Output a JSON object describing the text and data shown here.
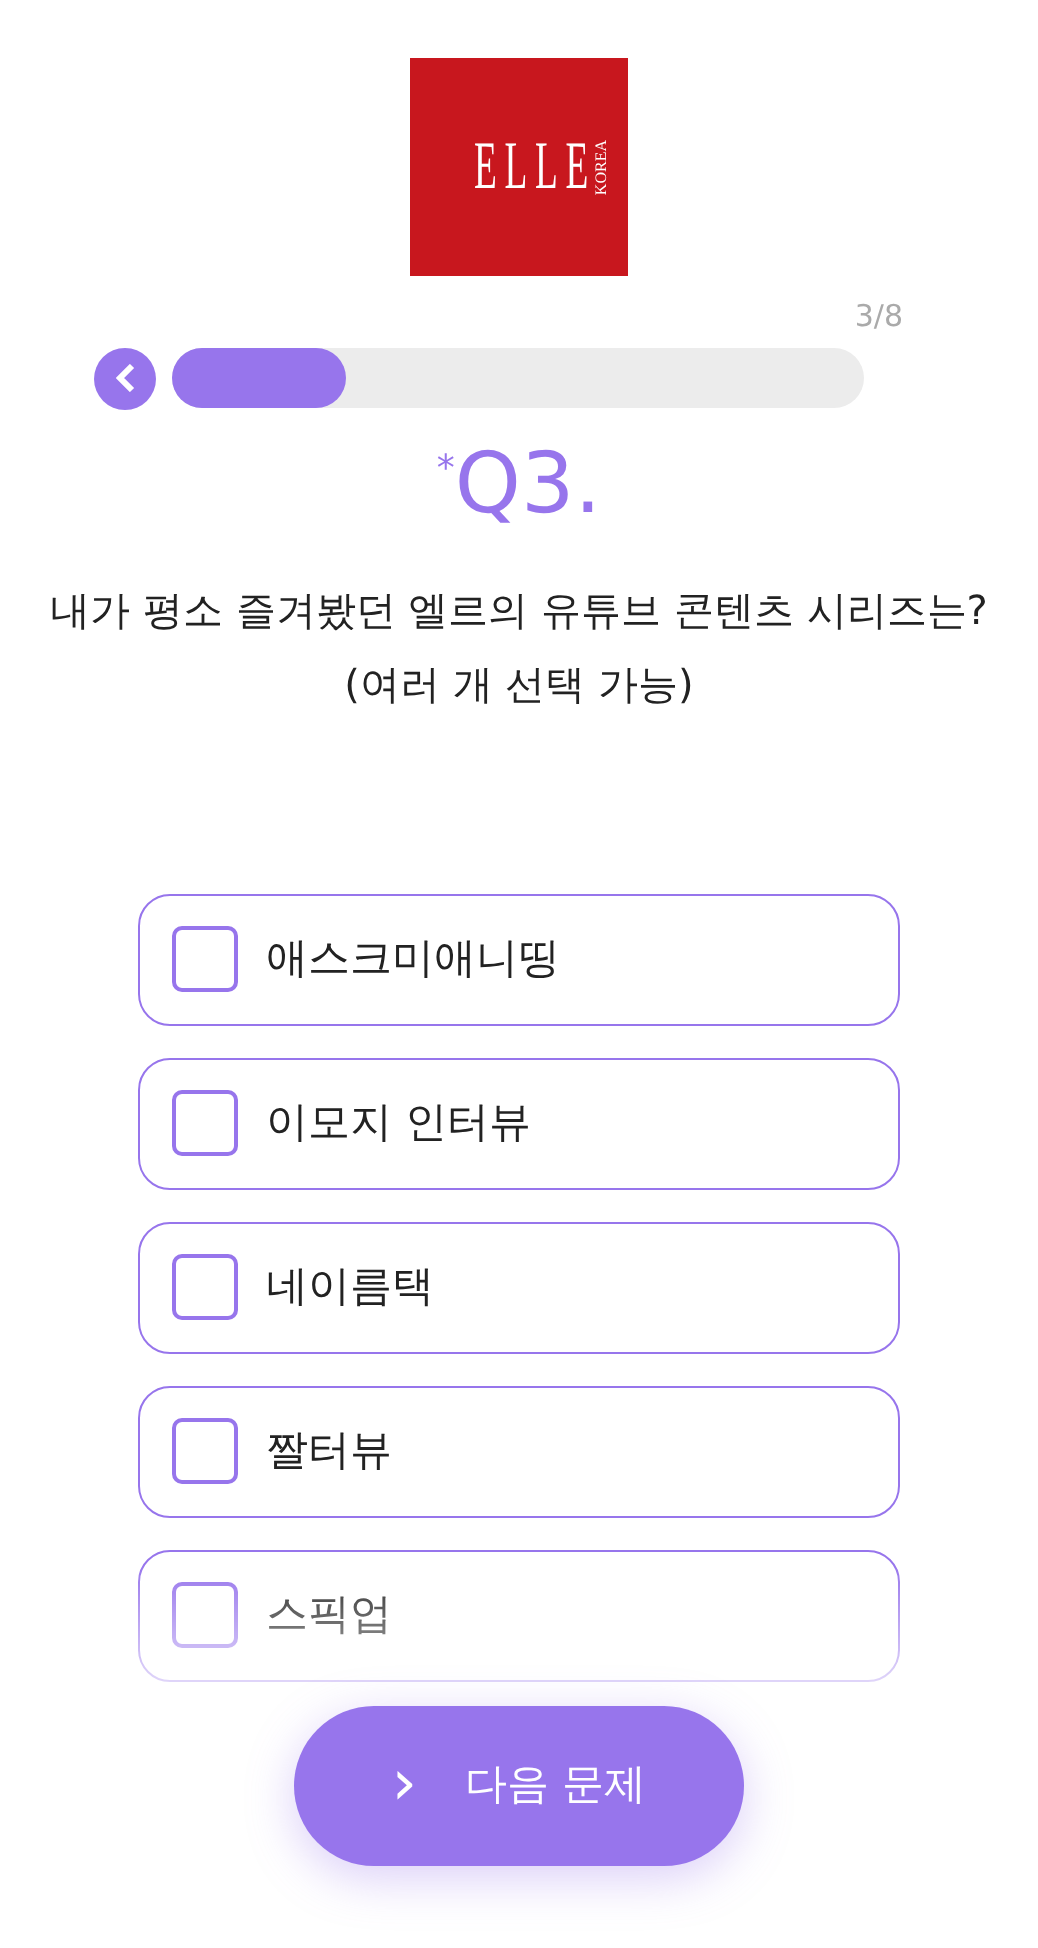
{
  "logo": {
    "letters": "ELLE",
    "edition": "KOREA"
  },
  "progress": {
    "counter": "3/8",
    "level": 0.25
  },
  "question": {
    "marker": "*",
    "number": "Q3.",
    "text": "내가 평소 즐겨봤던 엘르의 유튜브 콘텐츠 시리즈는?",
    "note": "(여러 개 선택 가능)"
  },
  "options": [
    {
      "label": "애스크미애니띵",
      "checked": false
    },
    {
      "label": "이모지 인터뷰",
      "checked": false
    },
    {
      "label": "네이름택",
      "checked": false
    },
    {
      "label": "짤터뷰",
      "checked": false
    },
    {
      "label": "스픽업",
      "checked": false
    }
  ],
  "next_button": {
    "icon": "›",
    "label": "다음 문제"
  }
}
